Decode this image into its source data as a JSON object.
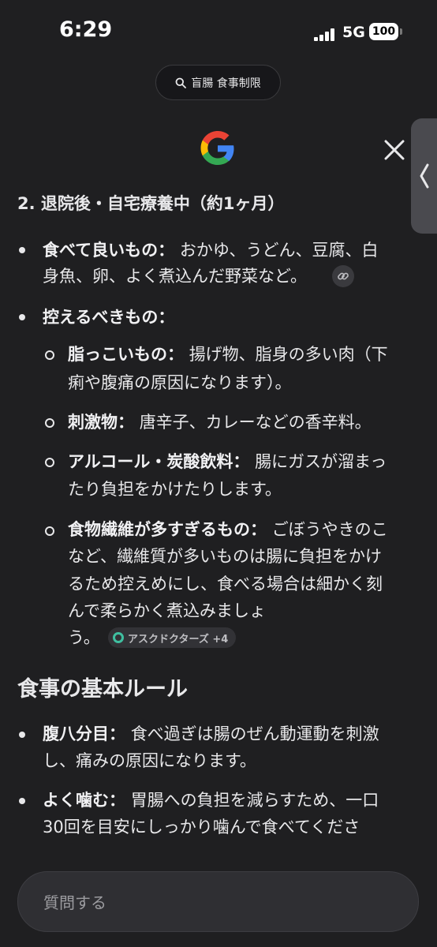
{
  "status": {
    "time": "6:29",
    "network": "5G",
    "battery": "100"
  },
  "search": {
    "query": "盲腸 食事制限"
  },
  "icons": {
    "logo": "google-g-logo",
    "close": "close-icon",
    "handle": "chevron-left-icon",
    "search": "search-icon",
    "link": "link-icon"
  },
  "content": {
    "heading": "2. 退院後・自宅療養中（約1ヶ月）",
    "good": {
      "label": "食べて良いもの：",
      "line1": "おかゆ、うどん、豆腐、白",
      "line2": "身魚、卵、よく煮込んだ野菜など。"
    },
    "avoid": {
      "label": "控えるべきもの：",
      "items": [
        {
          "label": "脂っこいもの：",
          "line1": "揚げ物、脂身の多い肉（下",
          "line2": "痢や腹痛の原因になります）。"
        },
        {
          "label": "刺激物：",
          "line1": "唐辛子、カレーなどの香辛料。"
        },
        {
          "label": "アルコール・炭酸飲料：",
          "line1": "腸にガスが溜まっ",
          "line2": "たり負担をかけたりします。"
        },
        {
          "label": "食物繊維が多すぎるもの：",
          "line1": "ごぼうやきのこ",
          "line2": "など、繊維質が多いものは腸に負担をかけ",
          "line3": "るため控えめにし、食べる場合は細かく刻",
          "line4": "んで柔らかく煮込みましょ",
          "line5": "う。"
        }
      ],
      "source_chip": "アスクドクターズ +4"
    },
    "rules_title": "食事の基本ルール",
    "rules": [
      {
        "label": "腹八分目：",
        "line1": "食べ過ぎは腸のぜん動運動を刺激",
        "line2": "し、痛みの原因になります。"
      },
      {
        "label": "よく噛む：",
        "line1": "胃腸への負担を減らすため、一口",
        "line2": "30回を目安にしっかり噛んで食べてくださ"
      }
    ]
  },
  "input": {
    "placeholder": "質問する"
  },
  "colors": {
    "background": "#1f1f21",
    "text": "#e8e8ea",
    "chip_accent": "#3fbfa0"
  }
}
